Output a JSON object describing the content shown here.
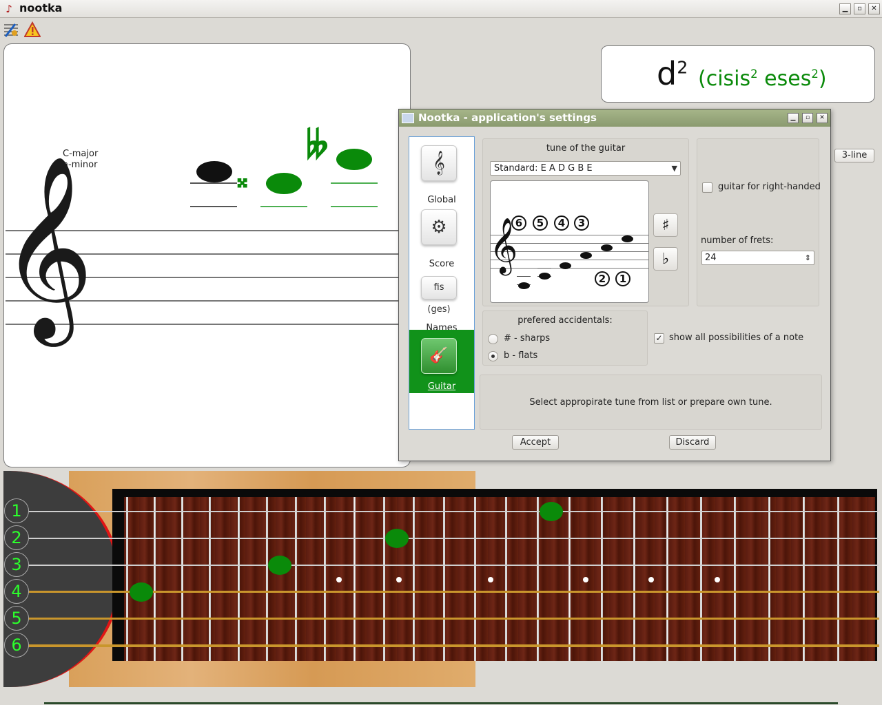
{
  "window": {
    "title": "nootka",
    "minimize": "▁",
    "maximize": "▫",
    "close": "✕"
  },
  "toolbar": {
    "settings_icon": "settings-icon",
    "levels_icon": "warning-icon"
  },
  "score": {
    "key_major": "C-major",
    "key_minor": "a-minor",
    "double_sharp": "𝄪",
    "double_flat": "𝄫"
  },
  "note_name": {
    "main": "d",
    "main_octave": "2",
    "alt_open": "(cisis",
    "alt_octave1": "2",
    "alt_mid": " eses",
    "alt_octave2": "2",
    "alt_close": ")"
  },
  "three_line_button": "3-line",
  "dialog": {
    "title": "Nootka - application's settings",
    "nav": [
      {
        "label": "Global",
        "icon": "𝄞"
      },
      {
        "label": "Score",
        "icon": "⚙"
      },
      {
        "label": "Names",
        "icon": "fis (ges)"
      },
      {
        "label": "Guitar",
        "icon": "🎸"
      }
    ],
    "tune_title": "tune of the guitar",
    "tune_value": "Standard: E A D G B E",
    "string_numbers_top": [
      "6",
      "5",
      "4",
      "3"
    ],
    "string_numbers_bottom": [
      "2",
      "1"
    ],
    "sharp_button": "♯",
    "flat_button": "♭",
    "right_handed_label": "guitar for right-handed",
    "right_handed_checked": false,
    "frets_label": "number of frets:",
    "frets_value": "24",
    "accidentals_title": "prefered accidentals:",
    "sharps_label": "# - sharps",
    "flats_label": "b - flats",
    "selected_accidental": "flats",
    "show_all_label": "show all possibilities of a note",
    "show_all_checked": true,
    "hint": "Select appropirate tune from list or prepare own tune.",
    "accept": "Accept",
    "discard": "Discard"
  },
  "guitar": {
    "string_numbers": [
      "1",
      "2",
      "3",
      "4",
      "5",
      "6"
    ],
    "highlight_color": "#0a8a0a"
  }
}
